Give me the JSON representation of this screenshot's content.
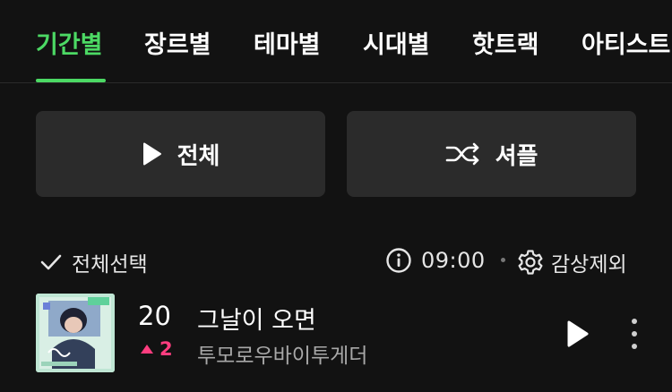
{
  "tabs": [
    {
      "label": "기간별",
      "active": true
    },
    {
      "label": "장르별",
      "active": false
    },
    {
      "label": "테마별",
      "active": false
    },
    {
      "label": "시대별",
      "active": false
    },
    {
      "label": "핫트랙",
      "active": false
    },
    {
      "label": "아티스트",
      "active": false
    }
  ],
  "actions": {
    "play_all_label": "전체",
    "shuffle_label": "셔플"
  },
  "toolbar": {
    "select_all_label": "전체선택",
    "time": "09:00",
    "exclude_label": "감상제외"
  },
  "songs": [
    {
      "rank": "20",
      "change_direction": "up",
      "change_value": "2",
      "title": "그날이 오면",
      "artist": "투모로우바이투게더"
    }
  ],
  "colors": {
    "accent": "#4cd964",
    "rank_up": "#ff3d7f",
    "background": "#121212",
    "button_bg": "#2b2b2b"
  },
  "icons": [
    "play-icon",
    "shuffle-icon",
    "check-icon",
    "info-icon",
    "gear-icon",
    "triangle-up-icon",
    "more-vertical-icon"
  ]
}
